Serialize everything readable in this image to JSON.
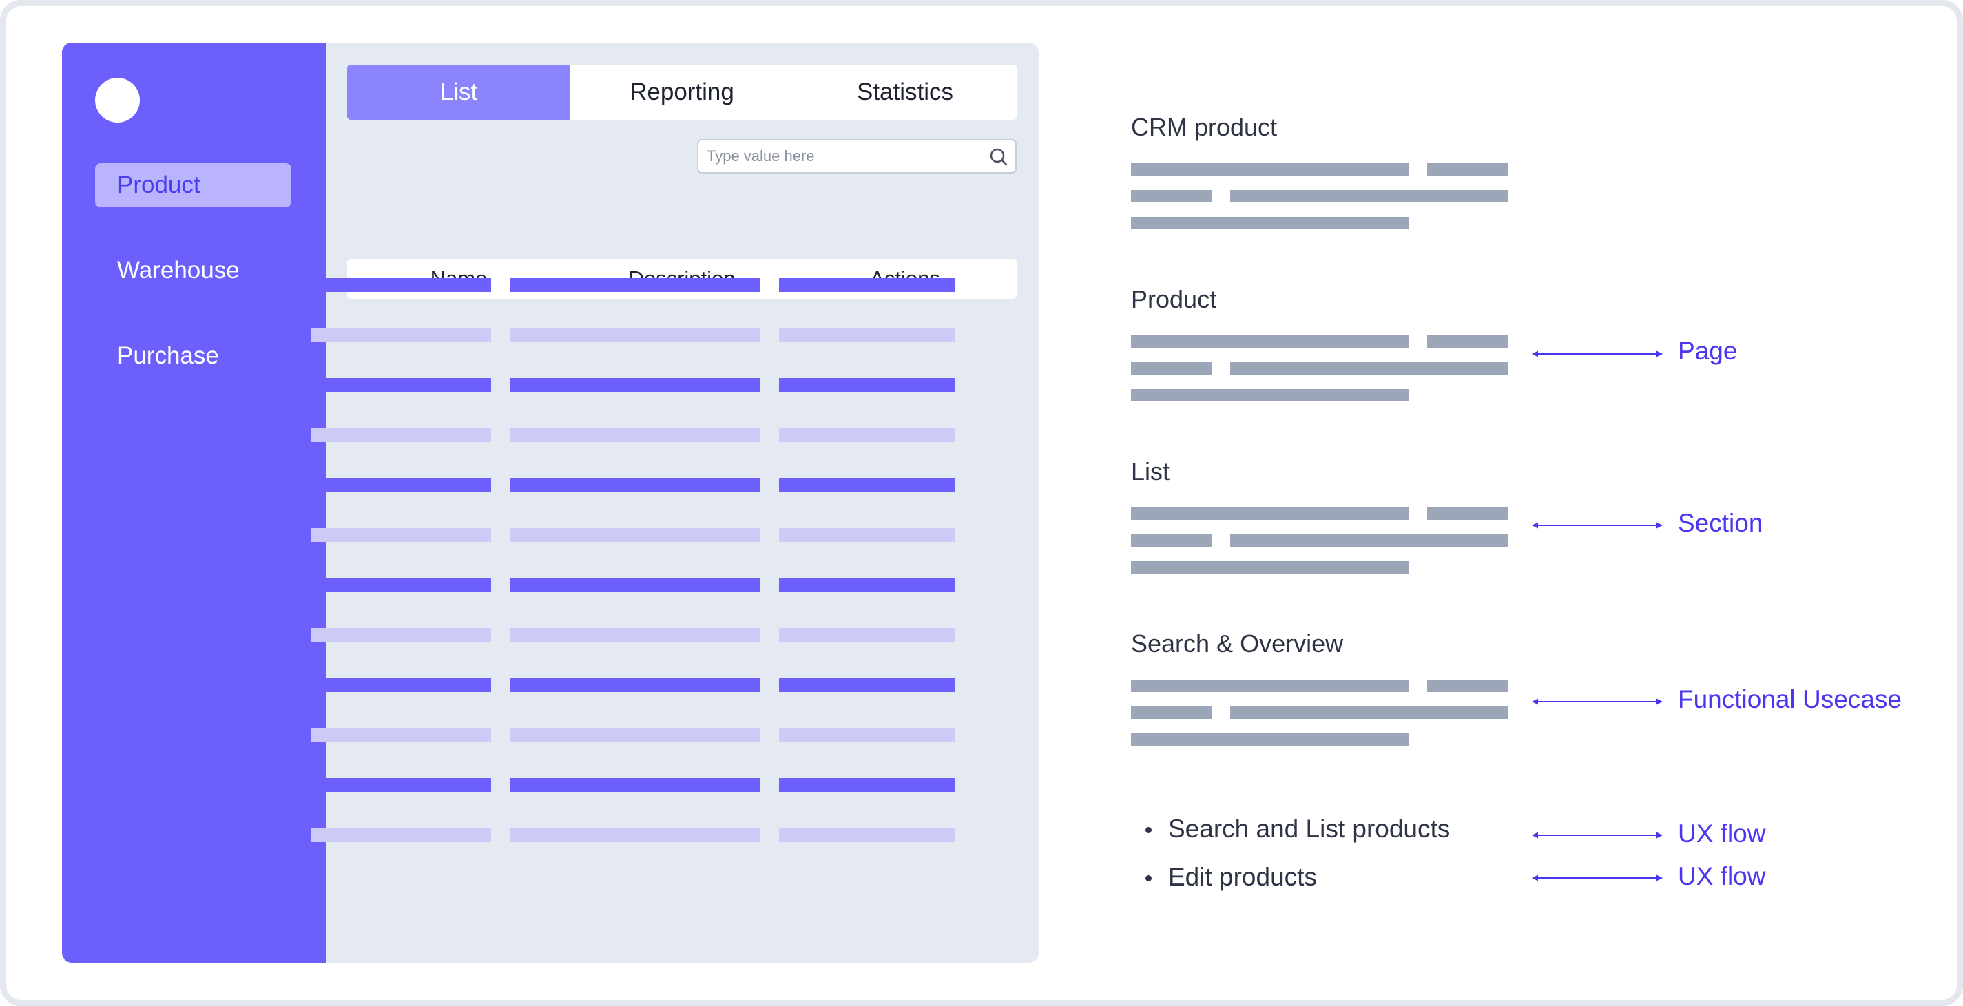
{
  "app": {
    "sidebar": {
      "items": [
        {
          "label": "Product",
          "active": true
        },
        {
          "label": "Warehouse",
          "active": false
        },
        {
          "label": "Purchase",
          "active": false
        }
      ]
    },
    "tabs": [
      {
        "label": "List",
        "active": true
      },
      {
        "label": "Reporting",
        "active": false
      },
      {
        "label": "Statistics",
        "active": false
      }
    ],
    "search": {
      "placeholder": "Type value here",
      "icon": "search-icon"
    },
    "table": {
      "columns": [
        "Name",
        "Description",
        "Actions"
      ],
      "row_count": 12
    }
  },
  "hierarchy": [
    {
      "title": "CRM product",
      "annotation": ""
    },
    {
      "title": "Product",
      "annotation": "Page"
    },
    {
      "title": "List",
      "annotation": "Section"
    },
    {
      "title": "Search & Overview",
      "annotation": "Functional Usecase"
    }
  ],
  "flows": [
    {
      "label": "Search and List products",
      "annotation": "UX flow"
    },
    {
      "label": "Edit products",
      "annotation": "UX flow"
    }
  ],
  "colors": {
    "accent": "#6c5ffc",
    "accent_light": "#cdcaf8",
    "annotation": "#4a35f0",
    "placeholder_bar": "#9ca6b9"
  }
}
